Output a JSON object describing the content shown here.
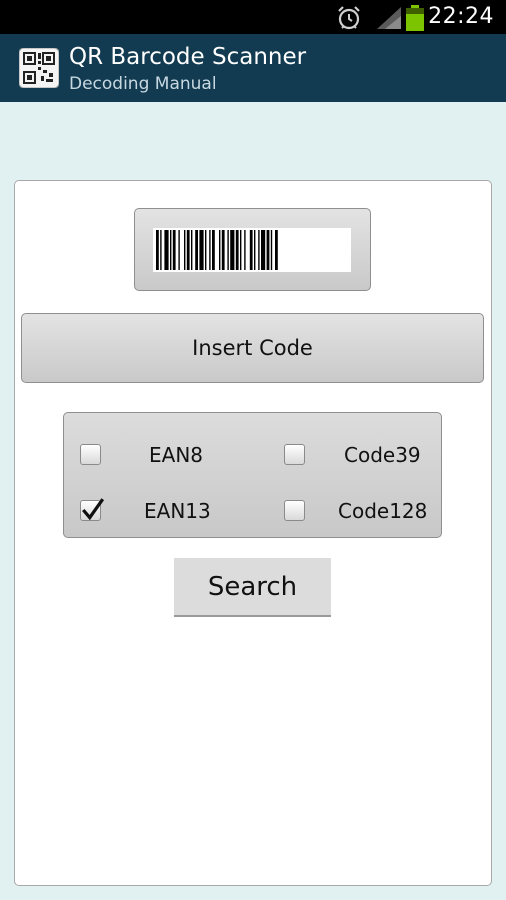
{
  "status_bar": {
    "time": "22:24",
    "icons": [
      "alarm-icon",
      "signal-icon",
      "battery-icon"
    ],
    "battery_color": "#7cc400"
  },
  "app_bar": {
    "title": "QR Barcode Scanner",
    "subtitle": "Decoding Manual",
    "background": "#123b52"
  },
  "form": {
    "barcode_button_icon": "barcode-icon",
    "insert_code_label": "Insert Code",
    "code_types": [
      {
        "label": "EAN8",
        "checked": false
      },
      {
        "label": "Code39",
        "checked": false
      },
      {
        "label": "EAN13",
        "checked": true
      },
      {
        "label": "Code128",
        "checked": false
      }
    ],
    "search_label": "Search"
  }
}
